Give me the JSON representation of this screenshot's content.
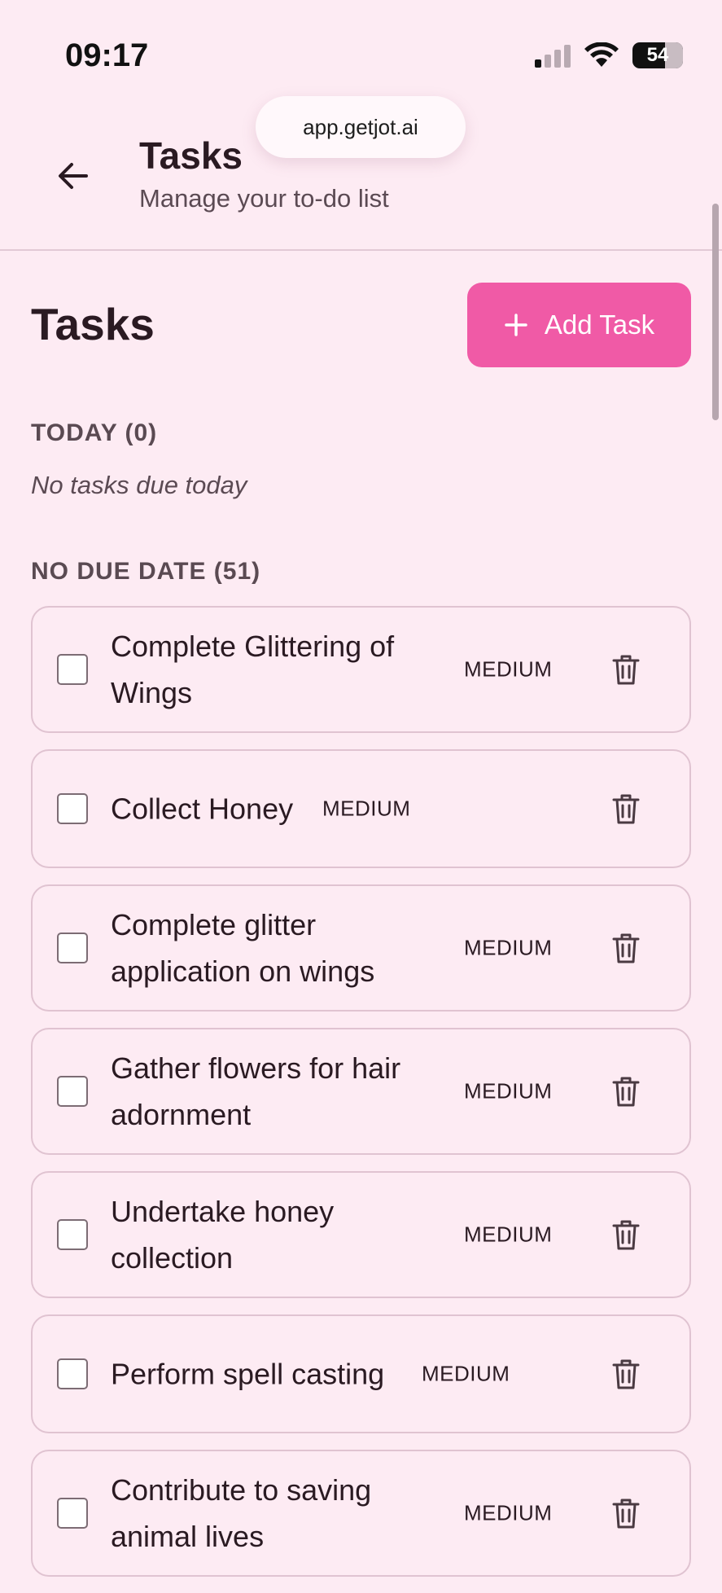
{
  "status": {
    "time": "09:17",
    "battery": "54"
  },
  "browser": {
    "url": "app.getjot.ai"
  },
  "header": {
    "title": "Tasks",
    "subtitle": "Manage your to-do list"
  },
  "main": {
    "title": "Tasks",
    "add_button_label": "Add Task",
    "today_label": "TODAY (0)",
    "today_empty": "No tasks due today",
    "no_due_label": "NO DUE DATE (51)"
  },
  "tasks": [
    {
      "lines": [
        "Complete Glittering of",
        "Wings"
      ],
      "priority": "MEDIUM"
    },
    {
      "lines": [
        "Collect Honey"
      ],
      "priority": "MEDIUM"
    },
    {
      "lines": [
        "Complete glitter",
        "application on wings"
      ],
      "priority": "MEDIUM"
    },
    {
      "lines": [
        "Gather flowers for hair",
        "adornment"
      ],
      "priority": "MEDIUM"
    },
    {
      "lines": [
        "Undertake honey",
        "collection"
      ],
      "priority": "MEDIUM"
    },
    {
      "lines": [
        "Perform spell casting"
      ],
      "priority": "MEDIUM"
    },
    {
      "lines": [
        "Contribute to saving",
        "animal lives"
      ],
      "priority": "MEDIUM"
    }
  ]
}
